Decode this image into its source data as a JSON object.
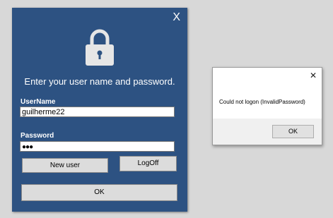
{
  "login": {
    "close_glyph": "X",
    "lock_icon": "lock-icon",
    "prompt": "Enter your user name and password.",
    "username_label": "UserName",
    "username_value": "guilherme22",
    "password_label": "Password",
    "password_value": "●●●",
    "new_user_label": "New user",
    "logoff_label": "LogOff",
    "ok_label": "OK",
    "colors": {
      "background": "#2d5282",
      "button": "#dcdcdc"
    }
  },
  "dialog": {
    "close_glyph": "✕",
    "message": "Could not logon (InvalidPassword)",
    "ok_label": "OK"
  }
}
